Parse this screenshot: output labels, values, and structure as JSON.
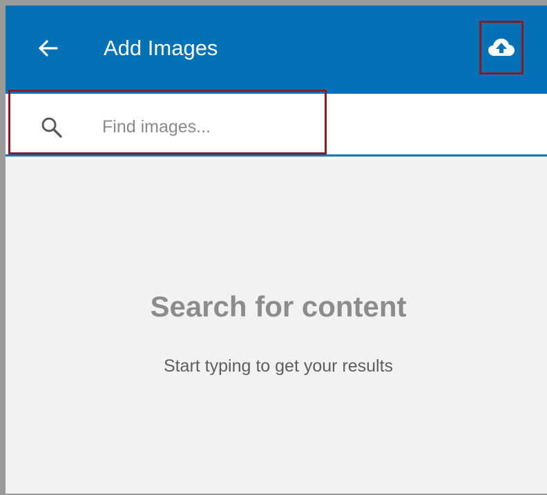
{
  "header": {
    "title": "Add Images",
    "back_icon": "arrow-left-icon",
    "upload_icon": "cloud-upload-icon",
    "background_color": "#0272b5"
  },
  "search": {
    "placeholder": "Find images...",
    "value": "",
    "icon": "search-icon"
  },
  "empty_state": {
    "title": "Search for content",
    "subtitle": "Start typing to get your results"
  },
  "highlight_color": "#8b1a24"
}
